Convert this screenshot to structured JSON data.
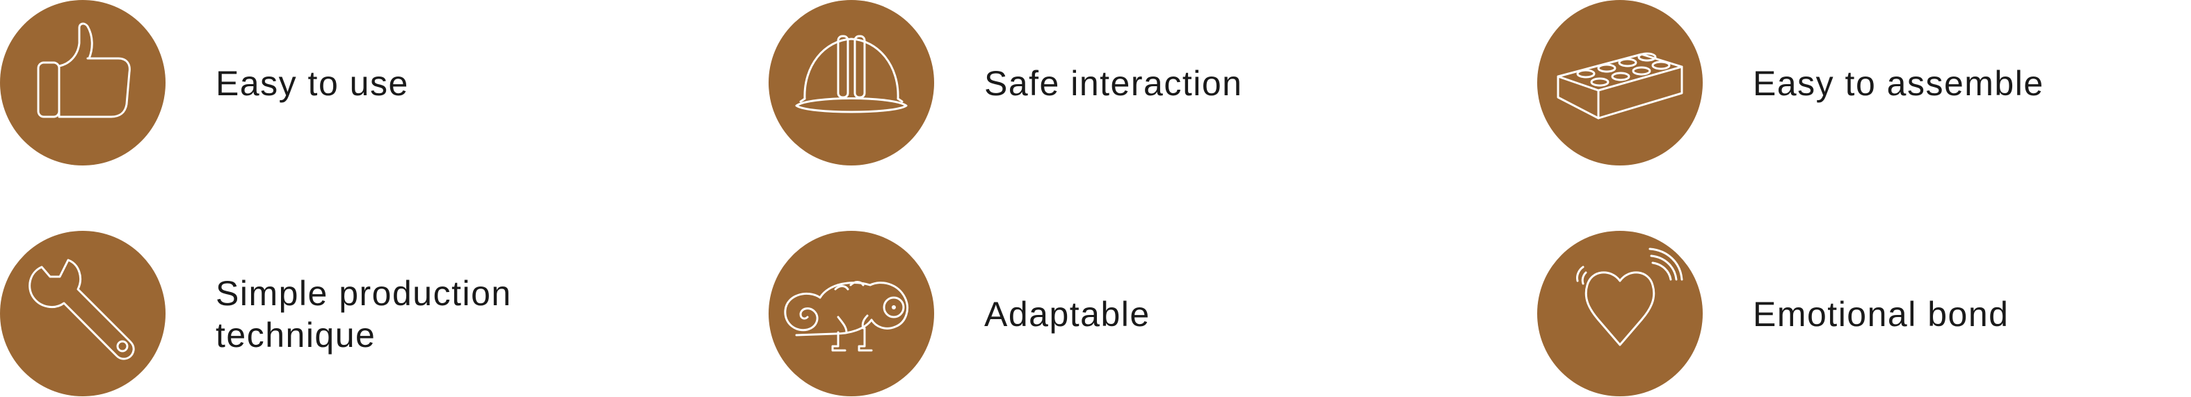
{
  "colors": {
    "accent": "#9b6733",
    "icon_stroke": "#ffffff",
    "text": "#1a1a1a",
    "background": "#ffffff"
  },
  "features": [
    {
      "label": "Easy to use",
      "icon": "thumbs-up-icon"
    },
    {
      "label": "Safe interaction",
      "icon": "hard-hat-icon"
    },
    {
      "label": "Easy to assemble",
      "icon": "building-brick-icon"
    },
    {
      "label": "Simple production\ntechnique",
      "icon": "wrench-icon"
    },
    {
      "label": "Adaptable",
      "icon": "chameleon-icon"
    },
    {
      "label": "Emotional bond",
      "icon": "heart-icon"
    }
  ]
}
